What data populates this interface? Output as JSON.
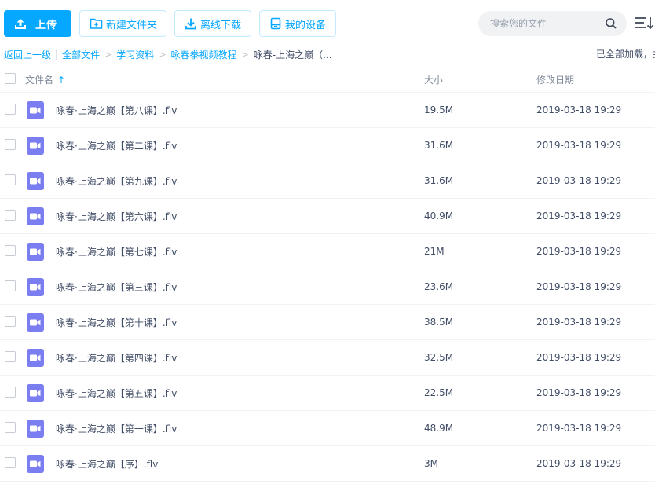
{
  "toolbar": {
    "upload_label": "上传",
    "new_folder_label": "新建文件夹",
    "offline_download_label": "离线下载",
    "my_devices_label": "我的设备"
  },
  "search": {
    "placeholder": "搜索您的文件"
  },
  "breadcrumb": {
    "back_label": "返回上一级",
    "separator": "|",
    "items": [
      "全部文件",
      "学习资料",
      "咏春拳视频教程"
    ],
    "arrow": ">",
    "current": "咏春-上海之巅（..."
  },
  "status": {
    "loaded_text": "已全部加载，共"
  },
  "table": {
    "headers": {
      "name": "文件名",
      "sort_arrow": "↑",
      "size": "大小",
      "modified": "修改日期"
    },
    "rows": [
      {
        "name": "咏春·上海之巅【第八课】.flv",
        "size": "19.5M",
        "date": "2019-03-18 19:29"
      },
      {
        "name": "咏春·上海之巅【第二课】.flv",
        "size": "31.6M",
        "date": "2019-03-18 19:29"
      },
      {
        "name": "咏春·上海之巅【第九课】.flv",
        "size": "31.6M",
        "date": "2019-03-18 19:29"
      },
      {
        "name": "咏春·上海之巅【第六课】.flv",
        "size": "40.9M",
        "date": "2019-03-18 19:29"
      },
      {
        "name": "咏春·上海之巅【第七课】.flv",
        "size": "21M",
        "date": "2019-03-18 19:29"
      },
      {
        "name": "咏春·上海之巅【第三课】.flv",
        "size": "23.6M",
        "date": "2019-03-18 19:29"
      },
      {
        "name": "咏春·上海之巅【第十课】.flv",
        "size": "38.5M",
        "date": "2019-03-18 19:29"
      },
      {
        "name": "咏春·上海之巅【第四课】.flv",
        "size": "32.5M",
        "date": "2019-03-18 19:29"
      },
      {
        "name": "咏春·上海之巅【第五课】.flv",
        "size": "22.5M",
        "date": "2019-03-18 19:29"
      },
      {
        "name": "咏春·上海之巅【第一课】.flv",
        "size": "48.9M",
        "date": "2019-03-18 19:29"
      },
      {
        "name": "咏春·上海之巅【序】.flv",
        "size": "3M",
        "date": "2019-03-18 19:29"
      }
    ]
  },
  "icons": {
    "upload": "upload-icon",
    "new_folder": "folder-plus-icon",
    "offline_download": "download-icon",
    "my_devices": "device-icon",
    "search": "search-icon",
    "view_toggle": "list-sort-icon",
    "file": "video-file-icon"
  },
  "colors": {
    "accent": "#06a7ff",
    "video_icon": "#7b7ef0",
    "text": "#424e67",
    "muted": "#818999"
  }
}
